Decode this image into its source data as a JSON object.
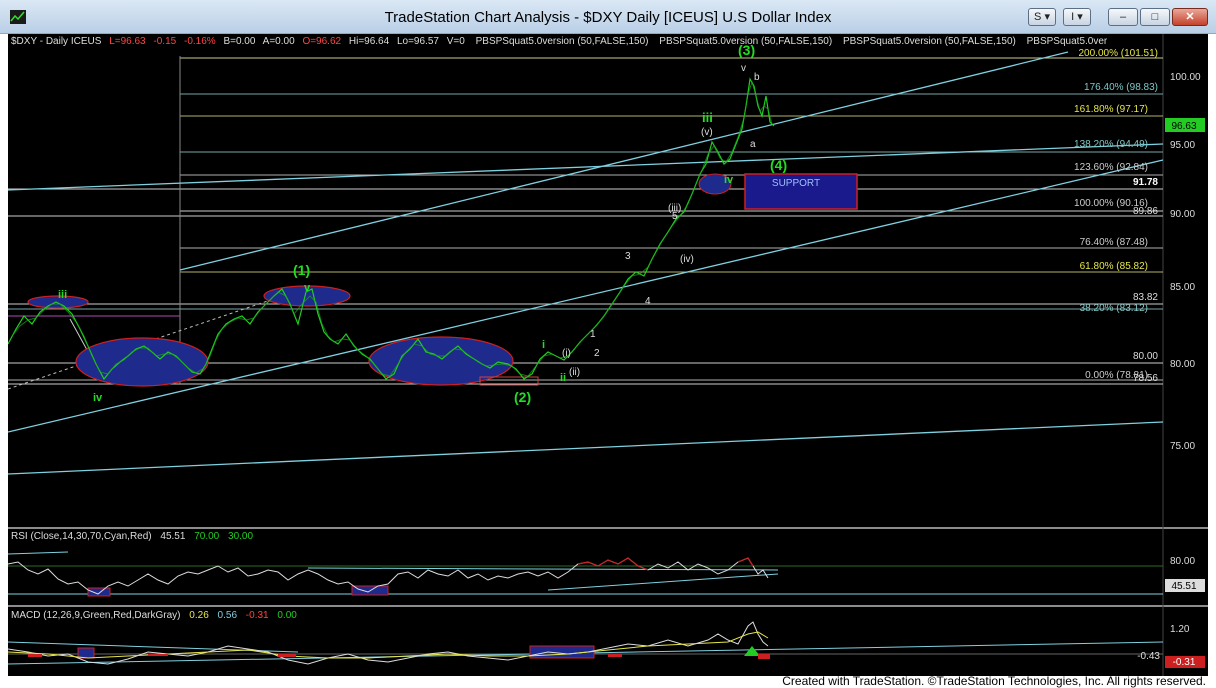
{
  "window": {
    "title": "TradeStation Chart Analysis - $DXY Daily [ICEUS] U.S Dollar Index",
    "s_button": "S",
    "i_button": "I",
    "min_glyph": "–",
    "max_glyph": "□",
    "close_glyph": "✕",
    "footer": "Created with TradeStation. ©TradeStation Technologies, Inc. All rights reserved."
  },
  "header": {
    "symbol": "$DXY - Daily  ICEUS",
    "last": "L=96.63",
    "change": "-0.15",
    "pct": "-0.16%",
    "bid": "B=0.00",
    "ask": "A=0.00",
    "open": "O=96.62",
    "high": "Hi=96.64",
    "low": "Lo=96.57",
    "volume": "V=0",
    "study1": "PBSPSquat5.0version (50,FALSE,150)",
    "study2": "PBSPSquat5.0version (50,FALSE,150)",
    "study3": "PBSPSquat5.0version (50,FALSE,150)",
    "study4": "PBSPSquat5.0ver"
  },
  "price_axis": {
    "ticks": [
      "100.00",
      "95.00",
      "90.00",
      "85.00",
      "80.00",
      "75.00"
    ],
    "last_price": "96.63",
    "level_labels": [
      "91.78",
      "89.86",
      "83.82",
      "80.00",
      "78.56"
    ]
  },
  "fib_labels": [
    "200.00% (101.51)",
    "176.40% (98.83)",
    "161.80% (97.17)",
    "138.20% (94.49)",
    "123.60% (92.84)",
    "100.00% (90.16)",
    "76.40% (87.48)",
    "61.80% (85.82)",
    "38.20% (83.12)",
    "0.00% (78.81)"
  ],
  "wave_labels": {
    "w3_main": "(3)",
    "w1_main": "(1)",
    "w2_main": "(2)",
    "w4_main": "(4)",
    "iii_left": "iii",
    "iv_left": "iv",
    "v_left": "v",
    "i_small": "i",
    "ii_small": "ii",
    "iii_big": "iii",
    "iv_big": "iv",
    "v_top": "v",
    "i_paren": "(i)",
    "ii_paren": "(ii)",
    "iii_paren": "(iii)",
    "iv_paren": "(iv)",
    "v_paren": "(v)",
    "n1": "1",
    "n2": "2",
    "n3": "3",
    "n4": "4",
    "n5": "5",
    "a": "a",
    "b": "b"
  },
  "support": {
    "label": "SUPPORT"
  },
  "rsi": {
    "label": "RSI (Close,14,30,70,Cyan,Red)",
    "value": "45.51",
    "ob": "70.00",
    "os": "30.00",
    "axis_tick": "80.00",
    "last": "45.51"
  },
  "macd": {
    "label": "MACD (12,26,9,Green,Red,DarkGray)",
    "v1": "0.26",
    "v2": "0.56",
    "v3": "-0.31",
    "v4": "0.00",
    "axis_top": "1.20",
    "axis_mid": "-0.43",
    "last": "-0.31"
  },
  "colors": {
    "price_line": "#22cc22",
    "wave_green": "#22dd22",
    "fib_line": "#9a9a6a",
    "trend_line": "#7fd0e0",
    "ellipse_fill": "#1e2a8c",
    "ellipse_edge": "#cc2020",
    "last_price_bg": "#22cc22"
  }
}
